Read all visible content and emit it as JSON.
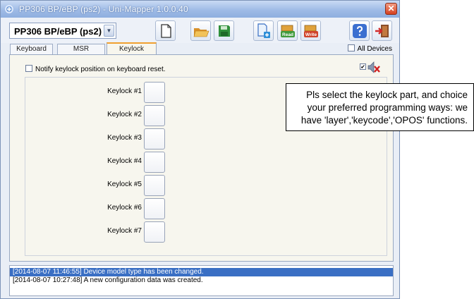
{
  "window": {
    "title": "PP306 BP/eBP (ps2)  - Uni-Mapper 1.0.0.40",
    "close_label": "✕"
  },
  "toolbar": {
    "model_value": "PP306 BP/eBP (ps2)",
    "dropdown_glyph": "▼",
    "read_label": "Read",
    "write_label": "Write"
  },
  "tabs": [
    {
      "label": "Keyboard"
    },
    {
      "label": "MSR"
    },
    {
      "label": "Keylock"
    }
  ],
  "all_devices_label": "All Devices",
  "notify_label": "Notify keylock position on keyboard reset.",
  "speaker_checked_glyph": "✔",
  "keylocks": [
    {
      "label": "Keylock #1"
    },
    {
      "label": "Keylock #2"
    },
    {
      "label": "Keylock #3"
    },
    {
      "label": "Keylock #4"
    },
    {
      "label": "Keylock #5"
    },
    {
      "label": "Keylock #6"
    },
    {
      "label": "Keylock #7"
    }
  ],
  "log": [
    {
      "text": "[2014-08-07 11:46:55] Device model type has been changed.",
      "selected": true
    },
    {
      "text": "[2014-08-07 10:27:48] A new configuration data was created.",
      "selected": false
    }
  ],
  "callout": {
    "lines": [
      "Pls select the keylock part, and  choice",
      "your preferred programming ways: we",
      "have 'layer','keycode','OPOS' functions."
    ]
  },
  "colors": {
    "title_bar": "#9fbbe6",
    "active_tab_accent": "#f0a030",
    "log_selection": "#3a6fc4",
    "close_button": "#d5401f"
  }
}
